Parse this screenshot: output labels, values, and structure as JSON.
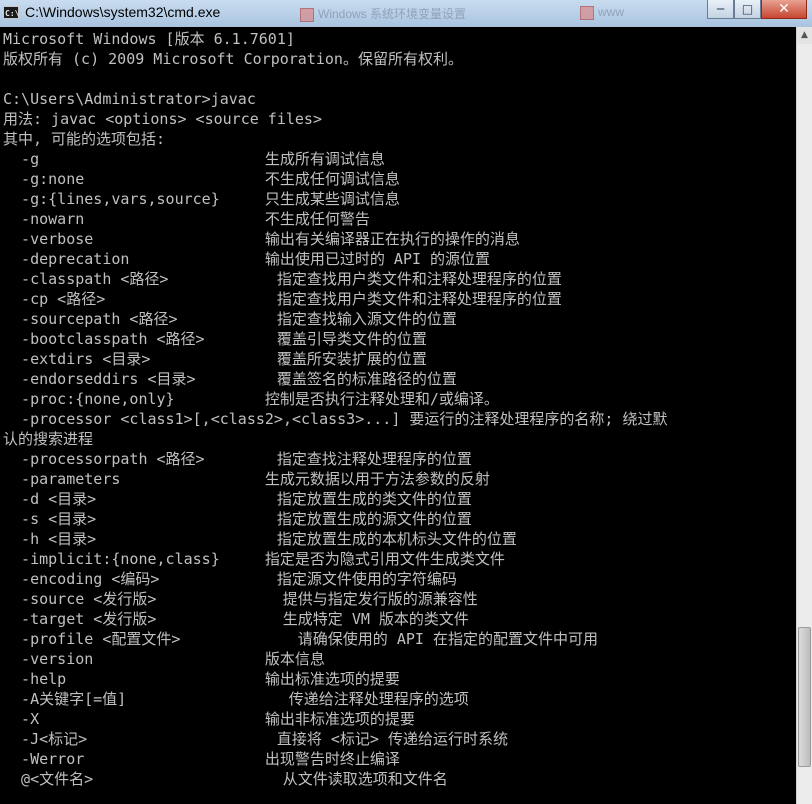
{
  "window": {
    "title": "C:\\Windows\\system32\\cmd.exe",
    "app_icon_text": "C:\\",
    "background_tabs": [
      "Windows 系统环境变量设置",
      "www"
    ],
    "buttons": {
      "minimize": "─",
      "maximize": "□",
      "close": "✕"
    }
  },
  "console": {
    "lines": [
      "Microsoft Windows [版本 6.1.7601]",
      "版权所有 (c) 2009 Microsoft Corporation。保留所有权利。",
      "",
      "C:\\Users\\Administrator>javac",
      "用法: javac <options> <source files>",
      "其中, 可能的选项包括:",
      "  -g                         生成所有调试信息",
      "  -g:none                    不生成任何调试信息",
      "  -g:{lines,vars,source}     只生成某些调试信息",
      "  -nowarn                    不生成任何警告",
      "  -verbose                   输出有关编译器正在执行的操作的消息",
      "  -deprecation               输出使用已过时的 API 的源位置",
      "  -classpath <路径>            指定查找用户类文件和注释处理程序的位置",
      "  -cp <路径>                   指定查找用户类文件和注释处理程序的位置",
      "  -sourcepath <路径>           指定查找输入源文件的位置",
      "  -bootclasspath <路径>        覆盖引导类文件的位置",
      "  -extdirs <目录>              覆盖所安装扩展的位置",
      "  -endorseddirs <目录>         覆盖签名的标准路径的位置",
      "  -proc:{none,only}          控制是否执行注释处理和/或编译。",
      "  -processor <class1>[,<class2>,<class3>...] 要运行的注释处理程序的名称; 绕过默",
      "认的搜索进程",
      "  -processorpath <路径>        指定查找注释处理程序的位置",
      "  -parameters                生成元数据以用于方法参数的反射",
      "  -d <目录>                    指定放置生成的类文件的位置",
      "  -s <目录>                    指定放置生成的源文件的位置",
      "  -h <目录>                    指定放置生成的本机标头文件的位置",
      "  -implicit:{none,class}     指定是否为隐式引用文件生成类文件",
      "  -encoding <编码>             指定源文件使用的字符编码",
      "  -source <发行版>              提供与指定发行版的源兼容性",
      "  -target <发行版>              生成特定 VM 版本的类文件",
      "  -profile <配置文件>             请确保使用的 API 在指定的配置文件中可用",
      "  -version                   版本信息",
      "  -help                      输出标准选项的提要",
      "  -A关键字[=值]                  传递给注释处理程序的选项",
      "  -X                         输出非标准选项的提要",
      "  -J<标记>                     直接将 <标记> 传递给运行时系统",
      "  -Werror                    出现警告时终止编译",
      "  @<文件名>                     从文件读取选项和文件名"
    ]
  },
  "scrollbar": {
    "up_arrow": "▲"
  },
  "colors": {
    "console_bg": "#000000",
    "console_fg": "#c0c0c0",
    "titlebar": "#bcd3ea"
  }
}
